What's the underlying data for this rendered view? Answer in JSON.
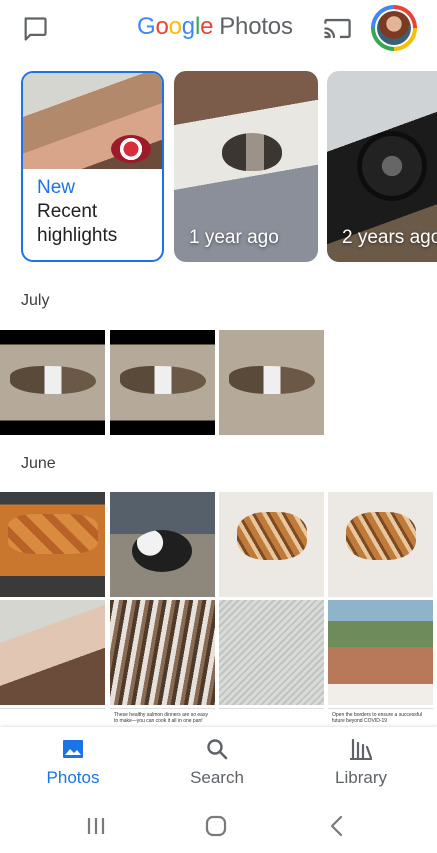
{
  "header": {
    "logo_google": [
      "G",
      "o",
      "o",
      "g",
      "l",
      "e"
    ],
    "logo_photos": "Photos",
    "chat_icon": "chat-bubble-icon",
    "cast_icon": "cast-icon",
    "avatar": "account-avatar"
  },
  "memories": [
    {
      "badge": "New",
      "title": "Recent highlights"
    },
    {
      "title": "1 year ago"
    },
    {
      "title": "2 years ago"
    }
  ],
  "sections": [
    {
      "label": "July",
      "photos": [
        "dog sleeping 1",
        "dog sleeping 2",
        "dog sleeping 3"
      ]
    },
    {
      "label": "June",
      "photos": [
        "salmon fillets",
        "black and white dog",
        "embroidery 1",
        "embroidery 2",
        "desk with flowers",
        "threads",
        "map embroidery",
        "tapestry",
        "article 1",
        "article 2",
        "article 3",
        "article 4"
      ]
    }
  ],
  "articles": {
    "left": "These healthy salmon dinners are so easy to make—you can cook it all in one pan!",
    "right": "Open the borders to ensure a successful future beyond COVID-19"
  },
  "bottom_nav": [
    {
      "label": "Photos",
      "icon": "photo-icon",
      "active": true
    },
    {
      "label": "Search",
      "icon": "search-icon",
      "active": false
    },
    {
      "label": "Library",
      "icon": "library-icon",
      "active": false
    }
  ],
  "system_nav": [
    "recents-icon",
    "home-icon",
    "back-icon"
  ],
  "colors": {
    "accent": "#1a73e8",
    "text": "#202124",
    "secondary": "#5f6368"
  }
}
